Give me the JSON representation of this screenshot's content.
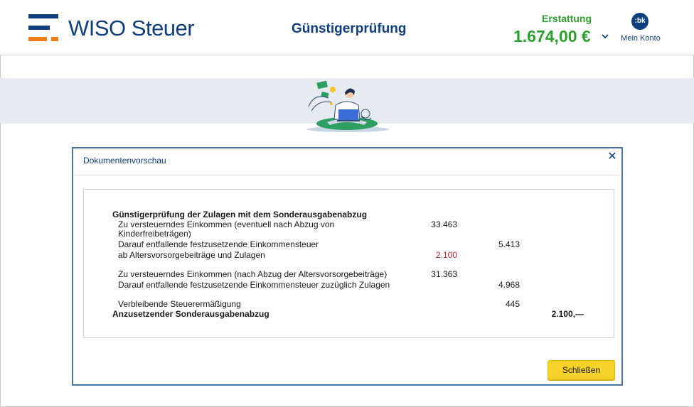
{
  "header": {
    "logo_text": "WISO Steuer",
    "title": "Günstigerprüfung",
    "refund_label": "Erstattung",
    "refund_value": "1.674,00 €",
    "avatar_text": ":bk",
    "account_label": "Mein Konto"
  },
  "colors": {
    "brand_blue": "#0e3f7c",
    "brand_orange": "#ef7d17",
    "refund_green": "#2e9e2e",
    "button_yellow": "#f6d22a",
    "highlight_red": "#c0262d"
  },
  "modal": {
    "title": "Dokumentenvorschau",
    "close_icon": "close-icon",
    "close_button_label": "Schließen"
  },
  "document": {
    "heading": "Günstigerprüfung der Zulagen mit dem Sonderausgabenabzug",
    "row1_label_a": "Zu versteuerndes Einkommen (eventuell nach Abzug von",
    "row1_label_b": "Kinderfreibeträgen)",
    "row1_value": "33.463",
    "row2_label": "Darauf entfallende festzusetzende Einkommensteuer",
    "row2_value": "5.413",
    "row3_label": "ab Altersvorsorgebeiträge und Zulagen",
    "row3_value": "2.100",
    "row4_label": "Zu versteuerndes Einkommen (nach Abzug der Altersvorsorgebeiträge)",
    "row4_value": "31.363",
    "row5_label": "Darauf entfallende festzusetzende Einkommensteuer zuzüglich Zulagen",
    "row5_value": "4.968",
    "row6_label": "Verbleibende Steuerermäßigung",
    "row6_value": "445",
    "result_label": "Anzusetzender Sonderausgabenabzug",
    "result_value": "2.100,—"
  }
}
